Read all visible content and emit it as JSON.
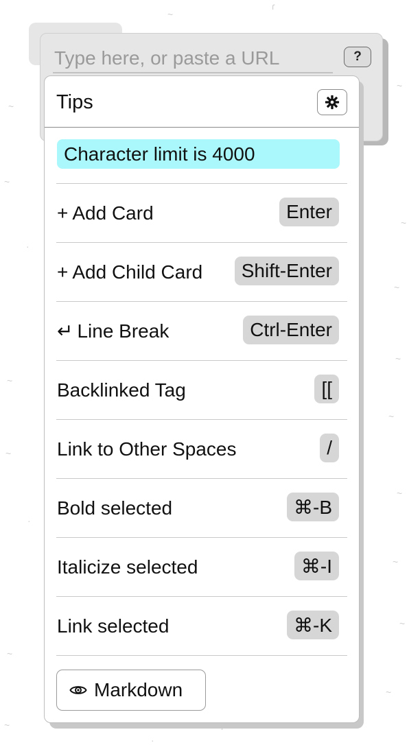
{
  "card": {
    "input_placeholder": "Type here, or paste a URL",
    "help_label": "?"
  },
  "tips": {
    "title": "Tips",
    "settings_icon": "gear-icon",
    "character_limit": "Character limit is 4000",
    "items": [
      {
        "icon": "+",
        "label": "Add Card",
        "key": "Enter"
      },
      {
        "icon": "+",
        "label": "Add Child Card",
        "key": "Shift-Enter"
      },
      {
        "icon": "↵",
        "label": "Line Break",
        "key": "Ctrl-Enter"
      },
      {
        "icon": "",
        "label": "Backlinked Tag",
        "key": "[["
      },
      {
        "icon": "",
        "label": "Link to Other Spaces",
        "key": "/"
      },
      {
        "icon": "",
        "label": "Bold selected",
        "key": "⌘-B"
      },
      {
        "icon": "",
        "label": "Italicize selected",
        "key": "⌘-I"
      },
      {
        "icon": "",
        "label": "Link selected",
        "key": "⌘-K"
      }
    ],
    "markdown_label": "Markdown",
    "markdown_icon": "eye-icon"
  },
  "colors": {
    "highlight": "#aaf8fb",
    "key_badge": "#d6d6d6",
    "card_bg": "#e6e6e6"
  }
}
